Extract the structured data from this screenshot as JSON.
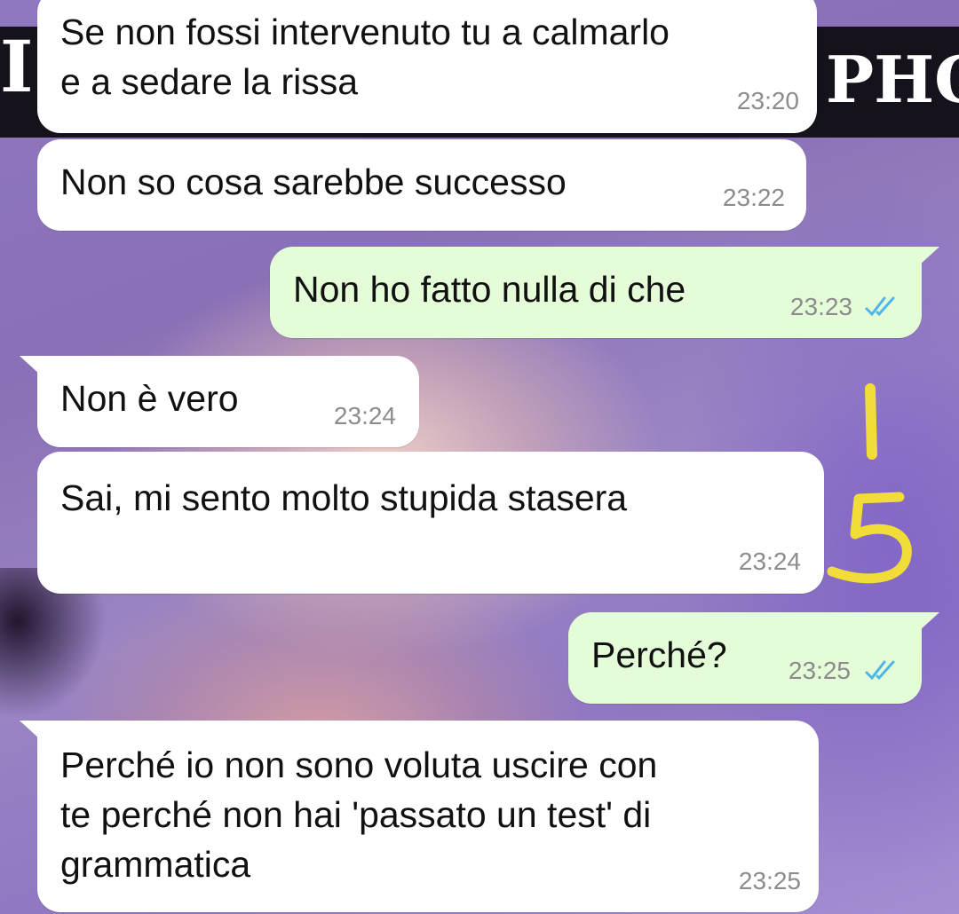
{
  "background": {
    "banner_letter_left": "I",
    "banner_letters_right": "PHO",
    "annotation_text": "15"
  },
  "messages": [
    {
      "dir": "in",
      "text": "Se non fossi intervenuto tu a calmarlo\ne a sedare la rissa",
      "time": "23:20"
    },
    {
      "dir": "in",
      "text": "Non so cosa sarebbe successo",
      "time": "23:22"
    },
    {
      "dir": "out",
      "text": "Non ho fatto nulla di che",
      "time": "23:23",
      "status": "read-ticks-icon"
    },
    {
      "dir": "in",
      "text": "Non è vero",
      "time": "23:24"
    },
    {
      "dir": "in",
      "text": "Sai, mi sento molto stupida stasera",
      "time": "23:24"
    },
    {
      "dir": "out",
      "text": "Perché?",
      "time": "23:25",
      "status": "read-ticks-icon"
    },
    {
      "dir": "in",
      "text": "Perché io non sono voluta uscire con\nte perché non hai 'passato un test' di\ngrammatica",
      "time": "23:25"
    }
  ],
  "colors": {
    "incoming_bubble": "#ffffff",
    "outgoing_bubble": "#e4fcd7",
    "timestamp": "#8c8c8c",
    "read_ticks": "#4fb6ec",
    "annotation": "#f2dc3a"
  }
}
